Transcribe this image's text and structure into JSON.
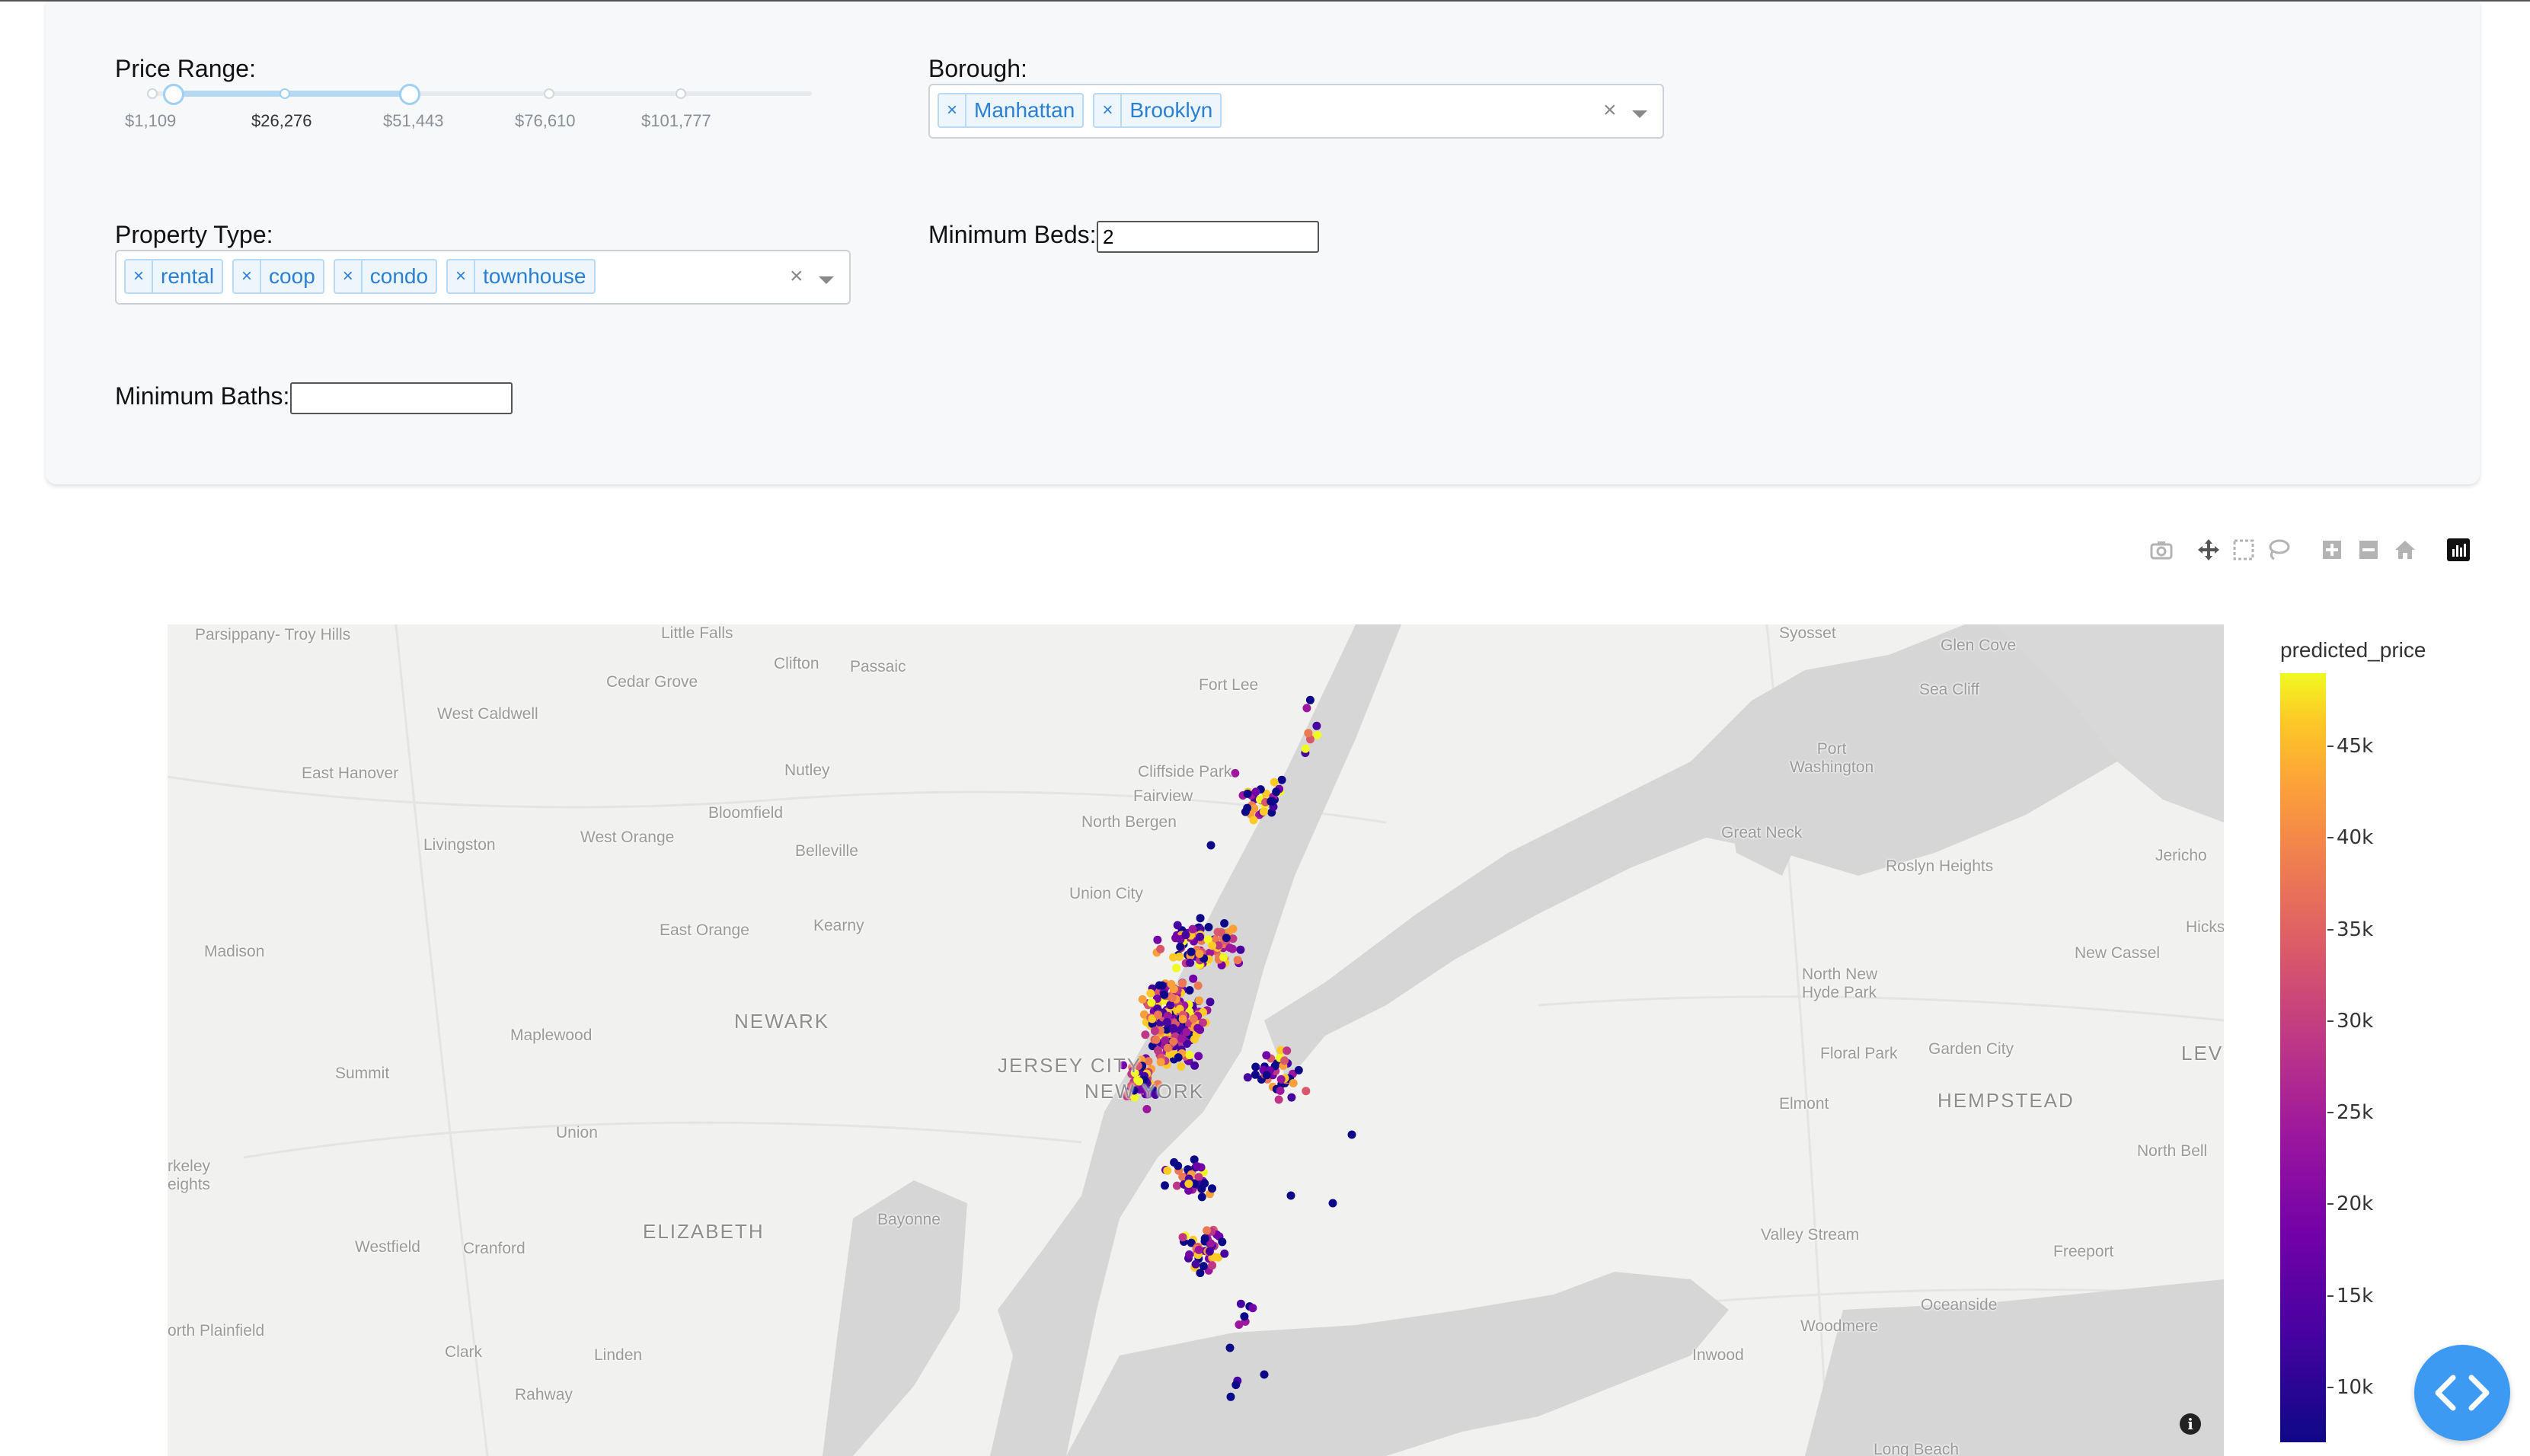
{
  "filters": {
    "price_range": {
      "label": "Price Range:",
      "marks": [
        "$1,109",
        "$26,276",
        "$51,443",
        "$76,610",
        "$101,777"
      ],
      "selected_low_fraction": 0.03,
      "selected_high_fraction": 0.37
    },
    "borough": {
      "label": "Borough:",
      "selected": [
        "Manhattan",
        "Brooklyn"
      ],
      "clear_glyph": "×"
    },
    "property_type": {
      "label": "Property Type:",
      "selected": [
        "rental",
        "coop",
        "condo",
        "townhouse"
      ],
      "clear_glyph": "×"
    },
    "min_beds": {
      "label": "Minimum Beds:",
      "value": "2"
    },
    "min_baths": {
      "label": "Minimum Baths:",
      "value": ""
    }
  },
  "modebar": {
    "icons": [
      "camera-icon",
      "pan-icon",
      "box-select-icon",
      "lasso-icon",
      "zoom-in-icon",
      "zoom-out-icon",
      "home-icon",
      "plotly-logo-icon"
    ]
  },
  "map": {
    "places": {
      "parsippany": "Parsippany-\nTroy Hills",
      "little_falls": "Little Falls",
      "clifton": "Clifton",
      "passaic": "Passaic",
      "cedar_grove": "Cedar Grove",
      "west_caldwell": "West Caldwell",
      "fort_lee": "Fort Lee",
      "glen_cove": "Glen Cove",
      "sea_cliff": "Sea Cliff",
      "east_hanover": "East Hanover",
      "nutley": "Nutley",
      "cliffside_park": "Cliffside Park",
      "fairview": "Fairview",
      "north_bergen": "North Bergen",
      "port_washington": "Port\nWashington",
      "bloomfield": "Bloomfield",
      "livingston": "Livingston",
      "west_orange": "West Orange",
      "belleville": "Belleville",
      "great_neck": "Great Neck",
      "roslyn_heights": "Roslyn Heights",
      "jericho": "Jericho",
      "union_city": "Union City",
      "east_orange": "East Orange",
      "kearny": "Kearny",
      "hicks": "Hicks",
      "madison": "Madison",
      "new_cassel": "New Cassel",
      "newark": "NEWARK",
      "north_new_hyde_park": "North New\nHyde Park",
      "maplewood": "Maplewood",
      "jersey_city": "JERSEY CITY",
      "floral_park": "Floral Park",
      "garden_city": "Garden City",
      "levi": "LEVI",
      "summit": "Summit",
      "new_york": "NEW YORK",
      "elmont": "Elmont",
      "hempstead": "HEMPSTEAD",
      "union": "Union",
      "north_bell": "North Bell",
      "berkeley_heights": "rkeley\neights",
      "bayonne": "Bayonne",
      "elizabeth": "ELIZABETH",
      "valley_stream": "Valley Stream",
      "westfield": "Westfield",
      "cranford": "Cranford",
      "freeport": "Freeport",
      "oceanside": "Oceanside",
      "north_plainfield": "orth Plainfield",
      "woodmere": "Woodmere",
      "clark": "Clark",
      "linden": "Linden",
      "inwood": "Inwood",
      "rahway": "Rahway",
      "long_beach": "Long Beach",
      "syosset": "Syosset"
    }
  },
  "colorbar": {
    "title": "predicted_price",
    "min": 7000,
    "max": 49000,
    "ticks": [
      {
        "value": 10000,
        "label": "10k"
      },
      {
        "value": 15000,
        "label": "15k"
      },
      {
        "value": 20000,
        "label": "20k"
      },
      {
        "value": 25000,
        "label": "25k"
      },
      {
        "value": 30000,
        "label": "30k"
      },
      {
        "value": 35000,
        "label": "35k"
      },
      {
        "value": 40000,
        "label": "40k"
      },
      {
        "value": 45000,
        "label": "45k"
      }
    ]
  },
  "colors": {
    "accent": "#2b7fd1",
    "fab": "#3d9af2"
  }
}
